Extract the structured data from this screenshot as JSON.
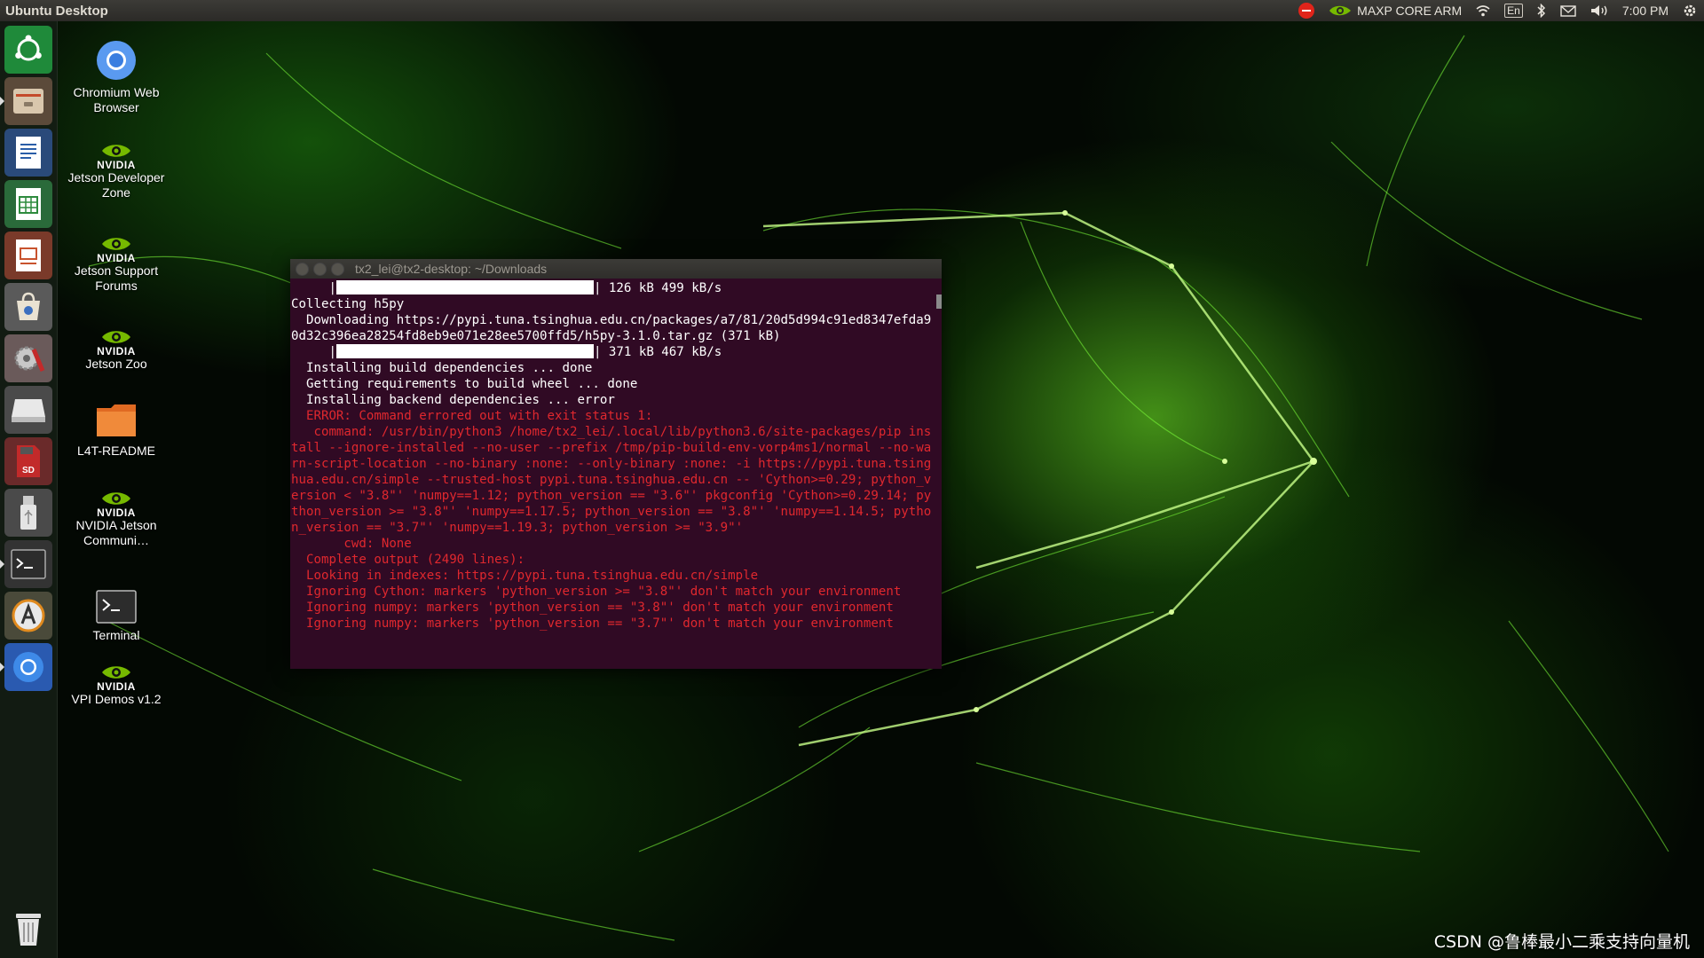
{
  "panel": {
    "title": "Ubuntu Desktop",
    "power_mode": "MAXP CORE ARM",
    "keyboard": "En",
    "time": "7:00 PM"
  },
  "launcher": [
    {
      "name": "ubuntu-dash-icon"
    },
    {
      "name": "files-icon"
    },
    {
      "name": "writer-icon"
    },
    {
      "name": "calc-icon"
    },
    {
      "name": "impress-icon"
    },
    {
      "name": "software-center-icon"
    },
    {
      "name": "system-settings-icon"
    },
    {
      "name": "drive-icon"
    },
    {
      "name": "sd-card-icon"
    },
    {
      "name": "usb-drive-icon"
    },
    {
      "name": "terminal-icon"
    },
    {
      "name": "software-updater-icon"
    },
    {
      "name": "chromium-icon"
    },
    {
      "name": "trash-icon"
    }
  ],
  "desktop_icons": {
    "chromium": "Chromium Web Browser",
    "dev_zone": "Jetson Developer Zone",
    "forums": "Jetson Support Forums",
    "zoo": "Jetson Zoo",
    "readme": "L4T-README",
    "community": "NVIDIA Jetson Communi…",
    "terminal": "Terminal",
    "vpi": "VPI Demos v1.2",
    "nvidia_word": "NVIDIA"
  },
  "terminal": {
    "title": "tx2_lei@tx2-desktop: ~/Downloads",
    "lines": [
      {
        "text": "     |",
        "bar": "| 126 kB 499 kB/s",
        "type": "progress"
      },
      {
        "text": "Collecting h5py",
        "type": "normal"
      },
      {
        "text": "  Downloading https://pypi.tuna.tsinghua.edu.cn/packages/a7/81/20d5d994c91ed8347efda90d32c396ea28254fd8eb9e071e28ee5700ffd5/h5py-3.1.0.tar.gz (371 kB)",
        "type": "normal"
      },
      {
        "text": "     |",
        "bar": "| 371 kB 467 kB/s",
        "type": "progress"
      },
      {
        "text": "  Installing build dependencies ... done",
        "type": "normal"
      },
      {
        "text": "  Getting requirements to build wheel ... done",
        "type": "normal"
      },
      {
        "text": "  Installing backend dependencies ... error",
        "type": "normal"
      },
      {
        "text": "  ERROR: Command errored out with exit status 1:",
        "type": "error"
      },
      {
        "text": "   command: /usr/bin/python3 /home/tx2_lei/.local/lib/python3.6/site-packages/pip install --ignore-installed --no-user --prefix /tmp/pip-build-env-vorp4ms1/normal --no-warn-script-location --no-binary :none: --only-binary :none: -i https://pypi.tuna.tsinghua.edu.cn/simple --trusted-host pypi.tuna.tsinghua.edu.cn -- 'Cython>=0.29; python_version < \"3.8\"' 'numpy==1.12; python_version == \"3.6\"' pkgconfig 'Cython>=0.29.14; python_version >= \"3.8\"' 'numpy==1.17.5; python_version == \"3.8\"' 'numpy==1.14.5; python_version == \"3.7\"' 'numpy==1.19.3; python_version >= \"3.9\"'",
        "type": "error"
      },
      {
        "text": "       cwd: None",
        "type": "error"
      },
      {
        "text": "  Complete output (2490 lines):",
        "type": "error"
      },
      {
        "text": "  Looking in indexes: https://pypi.tuna.tsinghua.edu.cn/simple",
        "type": "error"
      },
      {
        "text": "  Ignoring Cython: markers 'python_version >= \"3.8\"' don't match your environment",
        "type": "error"
      },
      {
        "text": "  Ignoring numpy: markers 'python_version == \"3.8\"' don't match your environment",
        "type": "error"
      },
      {
        "text": "  Ignoring numpy: markers 'python_version == \"3.7\"' don't match your environment",
        "type": "error"
      }
    ]
  },
  "watermark": "CSDN @鲁棒最小二乘支持向量机"
}
